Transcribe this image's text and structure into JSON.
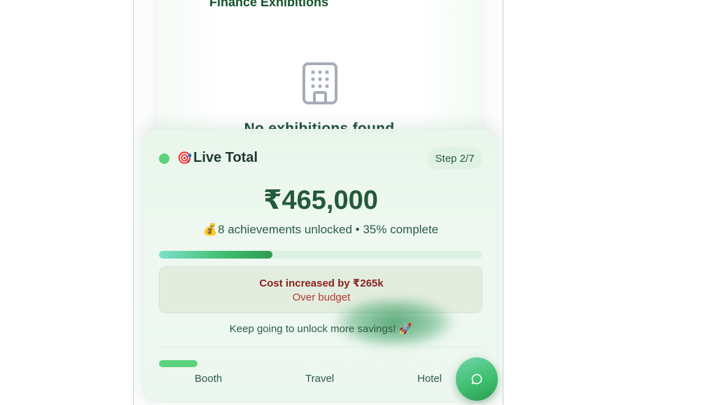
{
  "background_card": {
    "title": "Finance Exhibitions",
    "icon": "building-icon",
    "empty_message": "No exhibitions found"
  },
  "live_panel": {
    "emoji": "🎯",
    "title": "Live Total",
    "step": "Step 2/7",
    "amount": "₹465,000",
    "achievements_emoji": "💰",
    "achievements": "8 achievements unlocked • 35% complete",
    "progress_percent": 35,
    "alert": {
      "title": "Cost increased by ₹265k",
      "subtitle": "Over budget"
    },
    "encouragement": "Keep going to unlock more savings! 🚀"
  },
  "tabs": [
    {
      "label": "Booth",
      "active": true
    },
    {
      "label": "Travel",
      "active": false
    },
    {
      "label": "Hotel",
      "active": false
    }
  ],
  "chat_button": {
    "icon": "chat-icon"
  },
  "colors": {
    "accent_green": "#3dbd6b",
    "live_dot": "#5dd37d",
    "alert_title": "#8b1f1f",
    "alert_sub": "#b3382e"
  }
}
